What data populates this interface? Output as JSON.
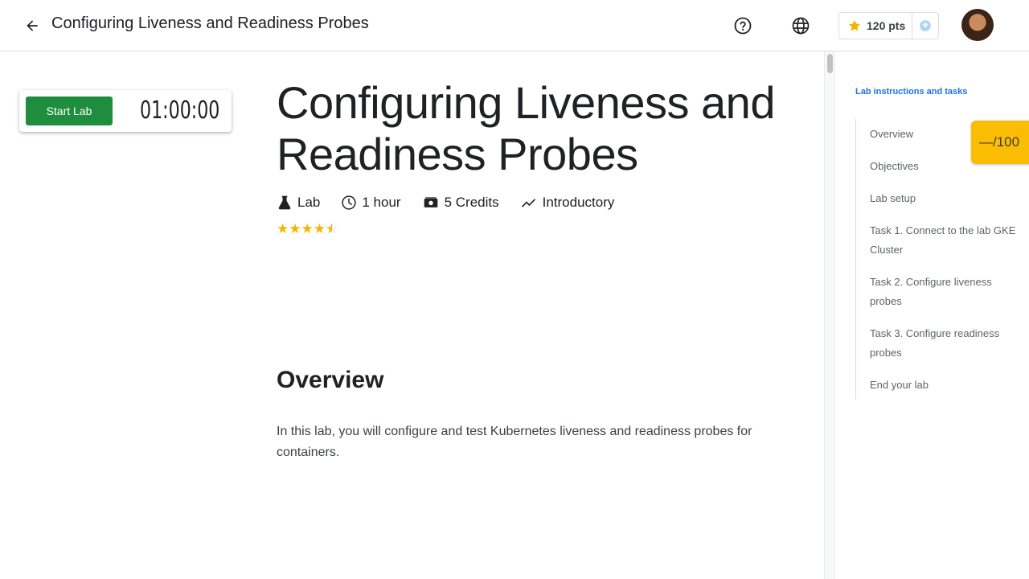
{
  "header": {
    "title": "Configuring Liveness and Readiness Probes",
    "points": "120 pts"
  },
  "lab_card": {
    "start_label": "Start Lab",
    "timer": "01:00:00"
  },
  "main": {
    "title": "Configuring Liveness and Readiness Probes",
    "meta": {
      "type": "Lab",
      "duration": "1 hour",
      "credits": "5 Credits",
      "level": "Introductory"
    },
    "rating_stars": 4.5,
    "overview_heading": "Overview",
    "overview_text": "In this lab, you will configure and test Kubernetes liveness and readiness probes for containers."
  },
  "toc": {
    "heading": "Lab instructions and tasks",
    "items": [
      "Overview",
      "Objectives",
      "Lab setup",
      "Task 1. Connect to the lab GKE Cluster",
      "Task 2. Configure liveness probes",
      "Task 3. Configure readiness probes",
      "End your lab"
    ]
  },
  "score": "—/100",
  "colors": {
    "start_button": "#1e8e3e",
    "accent_link": "#1a73e8",
    "score_badge": "#fbbc04",
    "star": "#f4b400"
  },
  "icons": {
    "back": "arrow-back-icon",
    "help": "help-circle-icon",
    "language": "globe-icon",
    "points": "star-icon",
    "gem": "gem-icon",
    "lab": "flask-icon",
    "duration": "clock-icon",
    "credits": "money-icon",
    "level": "trending-icon"
  }
}
